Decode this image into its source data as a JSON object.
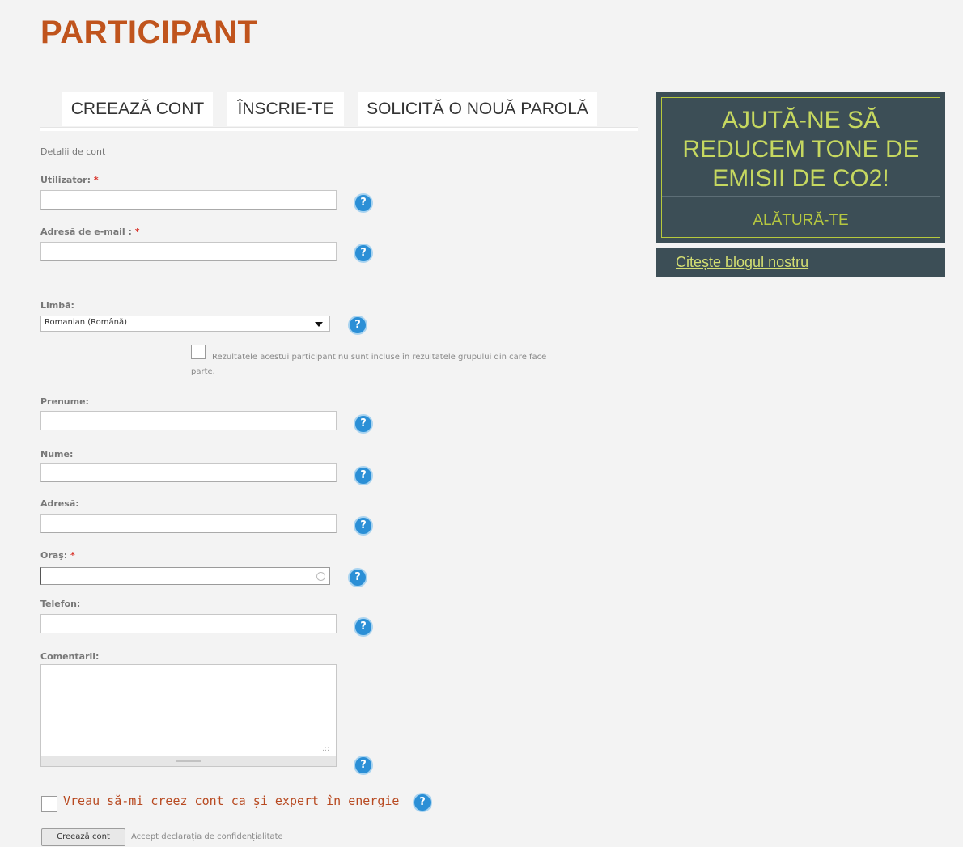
{
  "page": {
    "title": "PARTICIPANT"
  },
  "tabs": [
    {
      "label": "CREEAZĂ CONT"
    },
    {
      "label": "ÎNSCRIE-TE"
    },
    {
      "label": "SOLICITĂ O NOUĂ PAROLĂ"
    }
  ],
  "form": {
    "section_label": "Detalii de cont",
    "required_mark": "*",
    "help_glyph": "?",
    "username": {
      "label": "Utilizator:",
      "value": ""
    },
    "email": {
      "label": "Adresă de e-mail :",
      "value": ""
    },
    "language": {
      "label": "Limbă:",
      "selected": "Romanian (Română)"
    },
    "exclude_checkbox": {
      "checked": false,
      "text_line1": "Rezultatele acestui participant nu sunt incluse în rezultatele grupului din care face",
      "text_line2": "parte."
    },
    "first_name": {
      "label": "Prenume:",
      "value": ""
    },
    "last_name": {
      "label": "Nume:",
      "value": ""
    },
    "address": {
      "label": "Adresă:",
      "value": ""
    },
    "city": {
      "label": "Oraş:",
      "value": ""
    },
    "phone": {
      "label": "Telefon:",
      "value": ""
    },
    "comments": {
      "label": "Comentarii:",
      "value": ""
    },
    "expert_checkbox": {
      "checked": false,
      "label": "Vreau să-mi creez cont ca și expert în energie"
    },
    "submit_label": "Creează cont",
    "privacy_text": "Accept declarația de confidențialitate"
  },
  "sidebar": {
    "promo_headline_lines": [
      "AJUTĂ-NE SĂ",
      "REDUCEM TONE DE",
      "EMISII DE CO2!"
    ],
    "promo_link": "ALĂTURĂ-TE",
    "blog_link": "Citește blogul nostru"
  },
  "colors": {
    "title": "#c0541d",
    "help_icon": "#2b8fd6",
    "sidebar_bg": "#3c4e56",
    "sidebar_text": "#c6d860",
    "required": "#d9342b"
  }
}
